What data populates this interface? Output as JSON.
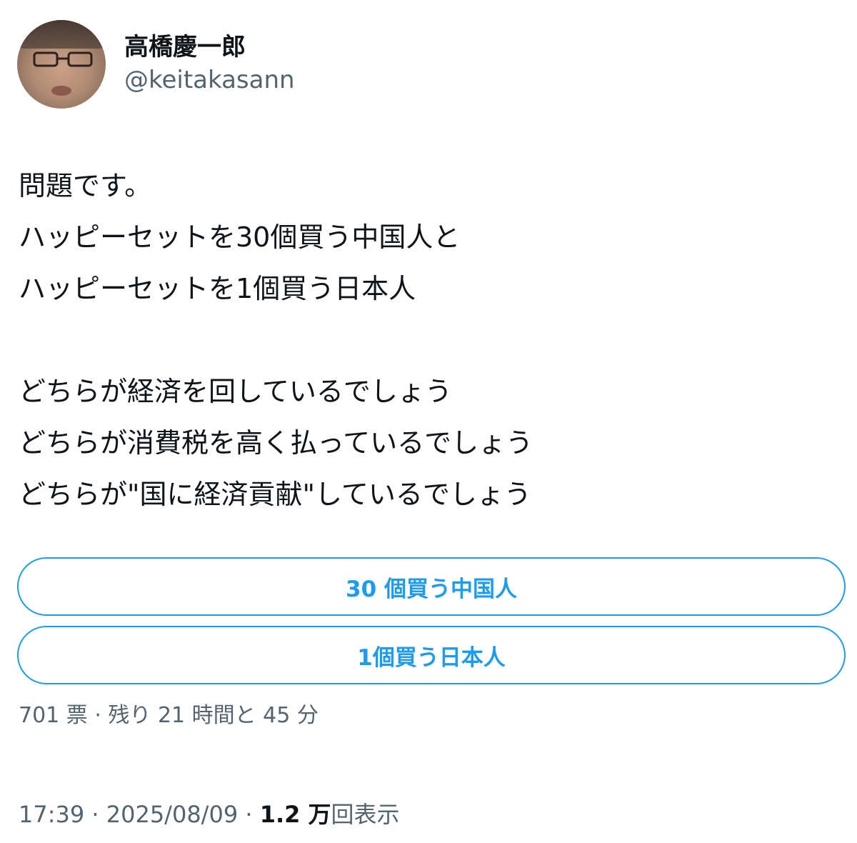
{
  "author": {
    "display_name": "高橋慶一郎",
    "handle": "@keitakasann"
  },
  "tweet": {
    "lines_block1": [
      "問題です。",
      "ハッピーセットを30個買う中国人と",
      "ハッピーセットを1個買う日本人"
    ],
    "lines_block2": [
      "どちらが経済を回しているでしょう",
      "どちらが消費税を高く払っているでしょう",
      "どちらが\"国に経済貢献\"しているでしょう"
    ]
  },
  "poll": {
    "options": [
      "30 個買う中国人",
      "1個買う日本人"
    ],
    "meta": "701 票 · 残り 21 時間と 45 分"
  },
  "footer": {
    "time": "17:39",
    "separator": " · ",
    "date": "2025/08/09",
    "views_count": "1.2 万",
    "views_label": "回表示"
  },
  "colors": {
    "accent": "#1d9bf0",
    "text_primary": "#0f1419",
    "text_secondary": "#536471",
    "background": "#ffffff"
  },
  "icons": {
    "avatar": "profile-photo"
  }
}
